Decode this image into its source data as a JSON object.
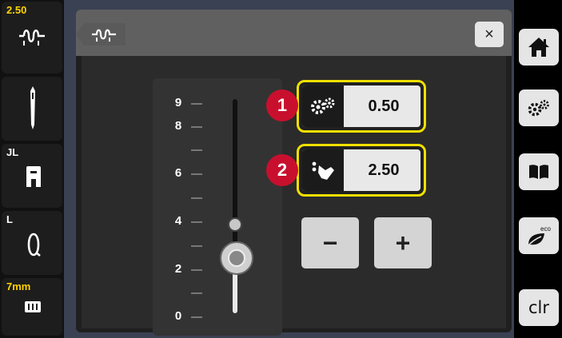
{
  "sidebar": {
    "stitch": {
      "label": "2.50",
      "icon": "stitch-pattern-icon"
    },
    "needle": {
      "icon": "needle-icon"
    },
    "foot": {
      "label": "JL",
      "icon": "presser-foot-icon"
    },
    "bobbin": {
      "label": "L",
      "icon": "bobbin-icon"
    },
    "plate": {
      "label": "7mm",
      "icon": "stitch-plate-icon"
    }
  },
  "toolbar": {
    "buttons": [
      "home-icon",
      "settings-gears-icon",
      "tutorial-book-icon",
      "eco-leaf-icon"
    ],
    "clr_label": "clr"
  },
  "dialog": {
    "header_icon": "stitch-pattern-icon",
    "close_label": "×",
    "slider": {
      "ticks": [
        "9",
        "8",
        "6",
        "4",
        "2",
        "0"
      ],
      "value": 2.5,
      "max": 9
    },
    "setting_1": {
      "badge": "1",
      "icon": "gears-icon",
      "value": "0.50"
    },
    "setting_2": {
      "badge": "2",
      "icon": "hand-tap-icon",
      "value": "2.50"
    },
    "minus_label": "−",
    "plus_label": "+"
  }
}
